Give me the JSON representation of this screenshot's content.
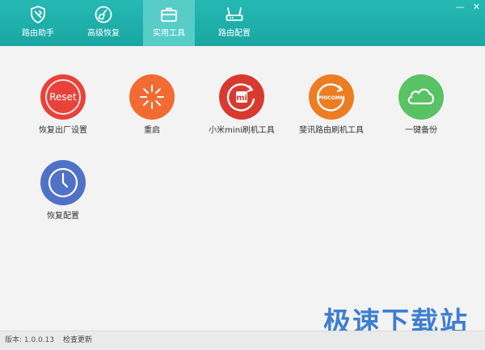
{
  "tabs": [
    {
      "label": "路由助手",
      "icon": "shield-wrench-icon",
      "active": false
    },
    {
      "label": "高级恢复",
      "icon": "broom-icon",
      "active": false
    },
    {
      "label": "实用工具",
      "icon": "toolbox-icon",
      "active": true
    },
    {
      "label": "路由配置",
      "icon": "router-icon",
      "active": false
    }
  ],
  "window": {
    "minimize_icon": "minimize-icon",
    "close_icon": "close-icon"
  },
  "tools": [
    {
      "label": "恢复出厂设置",
      "icon_text": "Reset",
      "icon": "reset-icon",
      "color": "#e8423b"
    },
    {
      "label": "重启",
      "icon": "restart-icon",
      "color": "#f26b32"
    },
    {
      "label": "小米mini刷机工具",
      "icon_text": "mi",
      "icon": "xiaomi-refresh-icon",
      "color": "#d83a30"
    },
    {
      "label": "斐讯路由刷机工具",
      "icon_text": "PHICOMM",
      "icon": "phicomm-refresh-icon",
      "color": "#ec7d23"
    },
    {
      "label": "一键备份",
      "icon": "cloud-backup-icon",
      "color": "#58c265"
    },
    {
      "label": "恢复配置",
      "icon": "clock-restore-icon",
      "color": "#5072c6"
    }
  ],
  "status": {
    "version": "版本: 1.0.0.13",
    "check_update": "检查更新"
  },
  "watermark": "极速下载站"
}
